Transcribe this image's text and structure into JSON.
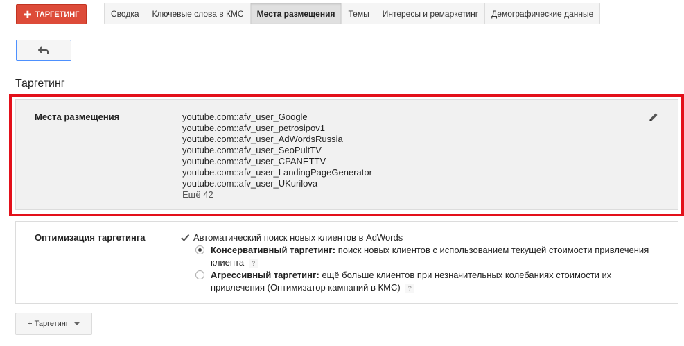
{
  "toolbar": {
    "targeting_button": "ТАРГЕТИНГ",
    "tabs": [
      {
        "label": "Сводка",
        "active": false
      },
      {
        "label": "Ключевые слова в КМС",
        "active": false
      },
      {
        "label": "Места размещения",
        "active": true
      },
      {
        "label": "Темы",
        "active": false
      },
      {
        "label": "Интересы и ремаркетинг",
        "active": false
      },
      {
        "label": "Демографические данные",
        "active": false
      }
    ]
  },
  "section_title": "Таргетинг",
  "placements": {
    "label": "Места размещения",
    "items": [
      "youtube.com::afv_user_Google",
      "youtube.com::afv_user_petrosipov1",
      "youtube.com::afv_user_AdWordsRussia",
      "youtube.com::afv_user_SeoPultTV",
      "youtube.com::afv_user_CPANETTV",
      "youtube.com::afv_user_LandingPageGenerator",
      "youtube.com::afv_user_UKurilova"
    ],
    "more": "Ещё 42"
  },
  "optimization": {
    "label": "Оптимизация таргетинга",
    "checkbox_label": "Автоматический поиск новых клиентов в AdWords",
    "checked": true,
    "conservative_title": "Консервативный таргетинг:",
    "conservative_text": "поиск новых клиентов с использованием текущей стоимости привлечения клиента",
    "aggressive_title": "Агрессивный таргетинг:",
    "aggressive_text": "ещё больше клиентов при незначительных колебаниях стоимости их привлечения (Оптимизатор кампаний в КМС)",
    "selected": "conservative",
    "help": "?"
  },
  "add_button": "+ Таргетинг",
  "colors": {
    "accent_red": "#dd4b39",
    "highlight": "#e3101a"
  }
}
